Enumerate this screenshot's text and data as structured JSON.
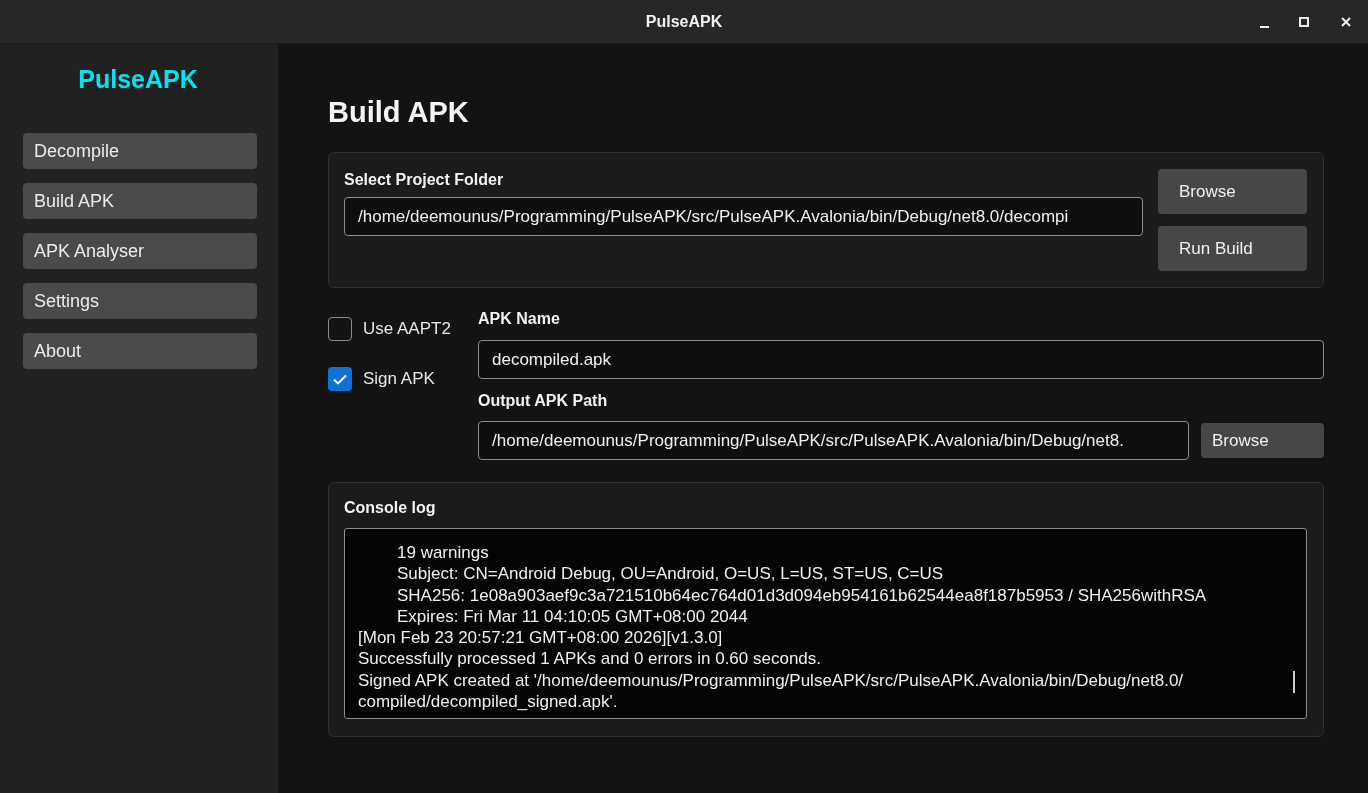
{
  "window": {
    "title": "PulseAPK"
  },
  "sidebar": {
    "logo": "PulseAPK",
    "items": [
      {
        "label": "Decompile"
      },
      {
        "label": "Build APK"
      },
      {
        "label": "APK Analyser"
      },
      {
        "label": "Settings"
      },
      {
        "label": "About"
      }
    ]
  },
  "page": {
    "title": "Build APK"
  },
  "project_panel": {
    "label": "Select Project Folder",
    "path": "/home/deemounus/Programming/PulseAPK/src/PulseAPK.Avalonia/bin/Debug/net8.0/decompi",
    "buttons": [
      "Browse",
      "Run Build"
    ]
  },
  "options": [
    {
      "label": "Use AAPT2",
      "checked": false
    },
    {
      "label": "Sign APK",
      "checked": true
    }
  ],
  "apk_name": {
    "label": "APK Name",
    "value": "decompiled.apk"
  },
  "output_path": {
    "label": "Output APK Path",
    "value": "/home/deemounus/Programming/PulseAPK/src/PulseAPK.Avalonia/bin/Debug/net8.",
    "button": "Browse"
  },
  "console": {
    "label": "Console log",
    "lines": [
      {
        "kind": "detail",
        "text": "19 warnings"
      },
      {
        "kind": "detail",
        "text": "Subject: CN=Android Debug, OU=Android, O=US, L=US, ST=US, C=US"
      },
      {
        "kind": "detail",
        "text": "SHA256: 1e08a903aef9c3a721510b64ec764d01d3d094eb954161b62544ea8f187b5953 / SHA256withRSA"
      },
      {
        "kind": "detail",
        "text": "Expires: Fri Mar 11 04:10:05 GMT+08:00 2044"
      },
      {
        "kind": "entry",
        "text": "[Mon Feb 23 20:57:21 GMT+08:00 2026][v1.3.0]"
      },
      {
        "kind": "entry",
        "text": "Successfully processed 1 APKs and 0 errors in 0.60 seconds."
      },
      {
        "kind": "entry",
        "text": "Signed APK created at '/home/deemounus/Programming/PulseAPK/src/PulseAPK.Avalonia/bin/Debug/net8.0/"
      },
      {
        "kind": "entry",
        "text": "compiled/decompiled_signed.apk'."
      }
    ]
  }
}
